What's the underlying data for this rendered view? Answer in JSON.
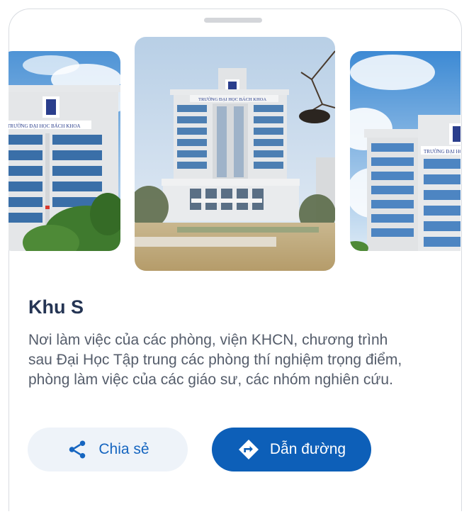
{
  "place": {
    "title": "Khu S",
    "description": "Nơi làm việc của các phòng, viện KHCN, chương trình sau Đại Học Tập trung các phòng thí nghiệm trọng điểm, phòng làm việc của các giáo sư, các nhóm nghiên cứu."
  },
  "gallery": {
    "center_sign": "TRƯỜNG ĐẠI HỌC BÁCH KHOA",
    "left_sign": "TRƯỜNG ĐẠI HỌC BÁCH KHOA",
    "right_sign": "TRƯỜNG ĐẠI HỌC"
  },
  "actions": {
    "share_label": "Chia sẻ",
    "directions_label": "Dẫn đường"
  },
  "colors": {
    "primary": "#0d5fb8",
    "title": "#253554",
    "secondary_button_bg": "#eef3f9"
  }
}
